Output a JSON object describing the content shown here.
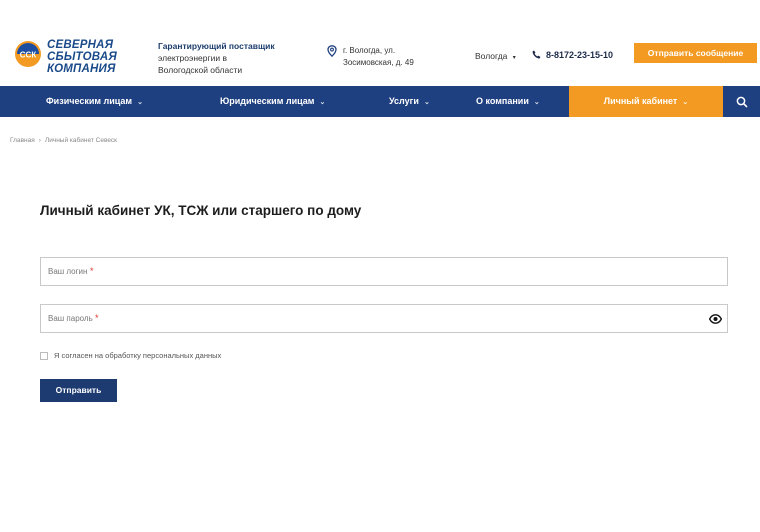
{
  "header": {
    "logo_abbr": "ССК",
    "logo_lines": [
      "СЕВЕРНАЯ",
      "СБЫТОВАЯ",
      "КОМПАНИЯ"
    ],
    "tagline_lines": [
      "Гарантирующий поставщик",
      "электроэнергии в",
      "Вологодской области"
    ],
    "address_lines": [
      "г. Вологда, ул.",
      "Зосимовская, д. 49"
    ],
    "city": "Вологда",
    "phone": "8-8172-23-15-10",
    "send_message_label": "Отправить сообщение"
  },
  "nav": {
    "items": [
      {
        "label": "Физическим лицам"
      },
      {
        "label": "Юридическим лицам"
      },
      {
        "label": "Услуги"
      },
      {
        "label": "О компании"
      },
      {
        "label": "Личный кабинет"
      }
    ]
  },
  "breadcrumb": [
    "Главная",
    "Личный кабинет Севеск"
  ],
  "main": {
    "title": "Личный кабинет УК, ТСЖ или старшего по дому",
    "login_placeholder": "Ваш логин",
    "password_placeholder": "Ваш пароль",
    "required_mark": "*",
    "consent_label": "Я согласен на обработку персональных данных",
    "submit_label": "Отправить"
  },
  "colors": {
    "nav_bg": "#1e3f80",
    "accent_orange": "#f39a22",
    "submit_bg": "#1d3b70",
    "required": "#e2322b"
  },
  "icons": [
    "logo-icon",
    "map-pin-icon",
    "phone-icon",
    "chevron-down-icon",
    "search-icon",
    "eye-icon"
  ]
}
